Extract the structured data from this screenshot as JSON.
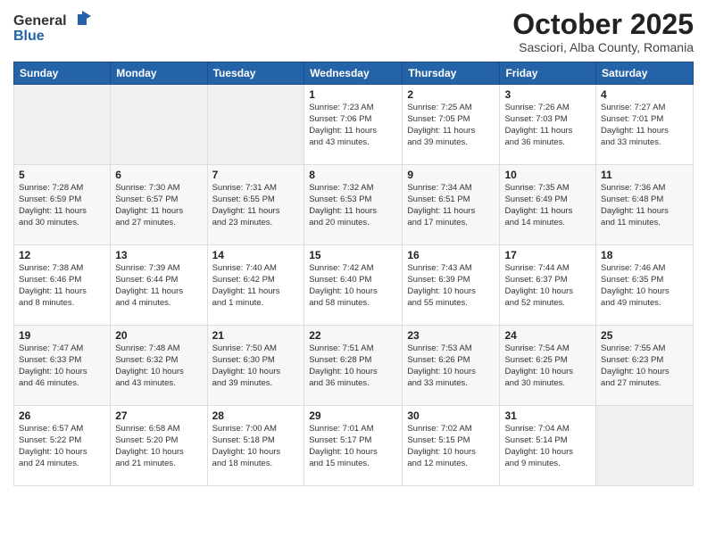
{
  "header": {
    "logo_general": "General",
    "logo_blue": "Blue",
    "month_title": "October 2025",
    "subtitle": "Sasciori, Alba County, Romania"
  },
  "weekdays": [
    "Sunday",
    "Monday",
    "Tuesday",
    "Wednesday",
    "Thursday",
    "Friday",
    "Saturday"
  ],
  "weeks": [
    [
      {
        "day": "",
        "info": ""
      },
      {
        "day": "",
        "info": ""
      },
      {
        "day": "",
        "info": ""
      },
      {
        "day": "1",
        "info": "Sunrise: 7:23 AM\nSunset: 7:06 PM\nDaylight: 11 hours\nand 43 minutes."
      },
      {
        "day": "2",
        "info": "Sunrise: 7:25 AM\nSunset: 7:05 PM\nDaylight: 11 hours\nand 39 minutes."
      },
      {
        "day": "3",
        "info": "Sunrise: 7:26 AM\nSunset: 7:03 PM\nDaylight: 11 hours\nand 36 minutes."
      },
      {
        "day": "4",
        "info": "Sunrise: 7:27 AM\nSunset: 7:01 PM\nDaylight: 11 hours\nand 33 minutes."
      }
    ],
    [
      {
        "day": "5",
        "info": "Sunrise: 7:28 AM\nSunset: 6:59 PM\nDaylight: 11 hours\nand 30 minutes."
      },
      {
        "day": "6",
        "info": "Sunrise: 7:30 AM\nSunset: 6:57 PM\nDaylight: 11 hours\nand 27 minutes."
      },
      {
        "day": "7",
        "info": "Sunrise: 7:31 AM\nSunset: 6:55 PM\nDaylight: 11 hours\nand 23 minutes."
      },
      {
        "day": "8",
        "info": "Sunrise: 7:32 AM\nSunset: 6:53 PM\nDaylight: 11 hours\nand 20 minutes."
      },
      {
        "day": "9",
        "info": "Sunrise: 7:34 AM\nSunset: 6:51 PM\nDaylight: 11 hours\nand 17 minutes."
      },
      {
        "day": "10",
        "info": "Sunrise: 7:35 AM\nSunset: 6:49 PM\nDaylight: 11 hours\nand 14 minutes."
      },
      {
        "day": "11",
        "info": "Sunrise: 7:36 AM\nSunset: 6:48 PM\nDaylight: 11 hours\nand 11 minutes."
      }
    ],
    [
      {
        "day": "12",
        "info": "Sunrise: 7:38 AM\nSunset: 6:46 PM\nDaylight: 11 hours\nand 8 minutes."
      },
      {
        "day": "13",
        "info": "Sunrise: 7:39 AM\nSunset: 6:44 PM\nDaylight: 11 hours\nand 4 minutes."
      },
      {
        "day": "14",
        "info": "Sunrise: 7:40 AM\nSunset: 6:42 PM\nDaylight: 11 hours\nand 1 minute."
      },
      {
        "day": "15",
        "info": "Sunrise: 7:42 AM\nSunset: 6:40 PM\nDaylight: 10 hours\nand 58 minutes."
      },
      {
        "day": "16",
        "info": "Sunrise: 7:43 AM\nSunset: 6:39 PM\nDaylight: 10 hours\nand 55 minutes."
      },
      {
        "day": "17",
        "info": "Sunrise: 7:44 AM\nSunset: 6:37 PM\nDaylight: 10 hours\nand 52 minutes."
      },
      {
        "day": "18",
        "info": "Sunrise: 7:46 AM\nSunset: 6:35 PM\nDaylight: 10 hours\nand 49 minutes."
      }
    ],
    [
      {
        "day": "19",
        "info": "Sunrise: 7:47 AM\nSunset: 6:33 PM\nDaylight: 10 hours\nand 46 minutes."
      },
      {
        "day": "20",
        "info": "Sunrise: 7:48 AM\nSunset: 6:32 PM\nDaylight: 10 hours\nand 43 minutes."
      },
      {
        "day": "21",
        "info": "Sunrise: 7:50 AM\nSunset: 6:30 PM\nDaylight: 10 hours\nand 39 minutes."
      },
      {
        "day": "22",
        "info": "Sunrise: 7:51 AM\nSunset: 6:28 PM\nDaylight: 10 hours\nand 36 minutes."
      },
      {
        "day": "23",
        "info": "Sunrise: 7:53 AM\nSunset: 6:26 PM\nDaylight: 10 hours\nand 33 minutes."
      },
      {
        "day": "24",
        "info": "Sunrise: 7:54 AM\nSunset: 6:25 PM\nDaylight: 10 hours\nand 30 minutes."
      },
      {
        "day": "25",
        "info": "Sunrise: 7:55 AM\nSunset: 6:23 PM\nDaylight: 10 hours\nand 27 minutes."
      }
    ],
    [
      {
        "day": "26",
        "info": "Sunrise: 6:57 AM\nSunset: 5:22 PM\nDaylight: 10 hours\nand 24 minutes."
      },
      {
        "day": "27",
        "info": "Sunrise: 6:58 AM\nSunset: 5:20 PM\nDaylight: 10 hours\nand 21 minutes."
      },
      {
        "day": "28",
        "info": "Sunrise: 7:00 AM\nSunset: 5:18 PM\nDaylight: 10 hours\nand 18 minutes."
      },
      {
        "day": "29",
        "info": "Sunrise: 7:01 AM\nSunset: 5:17 PM\nDaylight: 10 hours\nand 15 minutes."
      },
      {
        "day": "30",
        "info": "Sunrise: 7:02 AM\nSunset: 5:15 PM\nDaylight: 10 hours\nand 12 minutes."
      },
      {
        "day": "31",
        "info": "Sunrise: 7:04 AM\nSunset: 5:14 PM\nDaylight: 10 hours\nand 9 minutes."
      },
      {
        "day": "",
        "info": ""
      }
    ]
  ]
}
